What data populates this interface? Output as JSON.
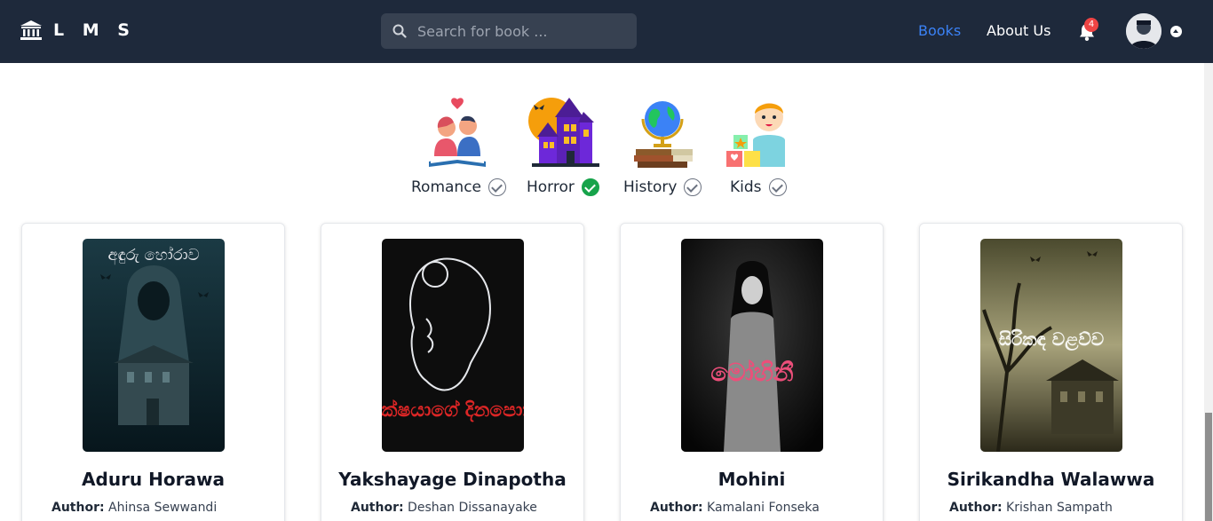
{
  "app": {
    "logo_text": "L M S"
  },
  "search": {
    "placeholder": "Search for book ..."
  },
  "nav": {
    "books": "Books",
    "about": "About Us",
    "notification_count": "4"
  },
  "categories": [
    {
      "label": "Romance",
      "icon": "romance-couple-book-icon",
      "checked": false
    },
    {
      "label": "Horror",
      "icon": "haunted-house-icon",
      "checked": true
    },
    {
      "label": "History",
      "icon": "globe-books-icon",
      "checked": false
    },
    {
      "label": "Kids",
      "icon": "child-blocks-icon",
      "checked": false
    }
  ],
  "books": [
    {
      "title": "Aduru Horawa",
      "author_label": "Author:",
      "author": "Ahinsa Sewwandi",
      "cover_text": "අඳුරු හෝරාව"
    },
    {
      "title": "Yakshayage Dinapotha",
      "author_label": "Author:",
      "author": "Deshan Dissanayake",
      "cover_text": "යක්ෂයාගේ දිනපොත"
    },
    {
      "title": "Mohini",
      "author_label": "Author:",
      "author": "Kamalani Fonseka",
      "cover_text": "මෝහිනී"
    },
    {
      "title": "Sirikandha Walawwa",
      "author_label": "Author:",
      "author": "Krishan Sampath",
      "cover_text": "සිරිකඳ වළව්ව"
    }
  ],
  "colors": {
    "nav_bg": "#1e293b",
    "accent": "#3b82f6",
    "check_active": "#16a34a",
    "badge": "#ef4444"
  }
}
